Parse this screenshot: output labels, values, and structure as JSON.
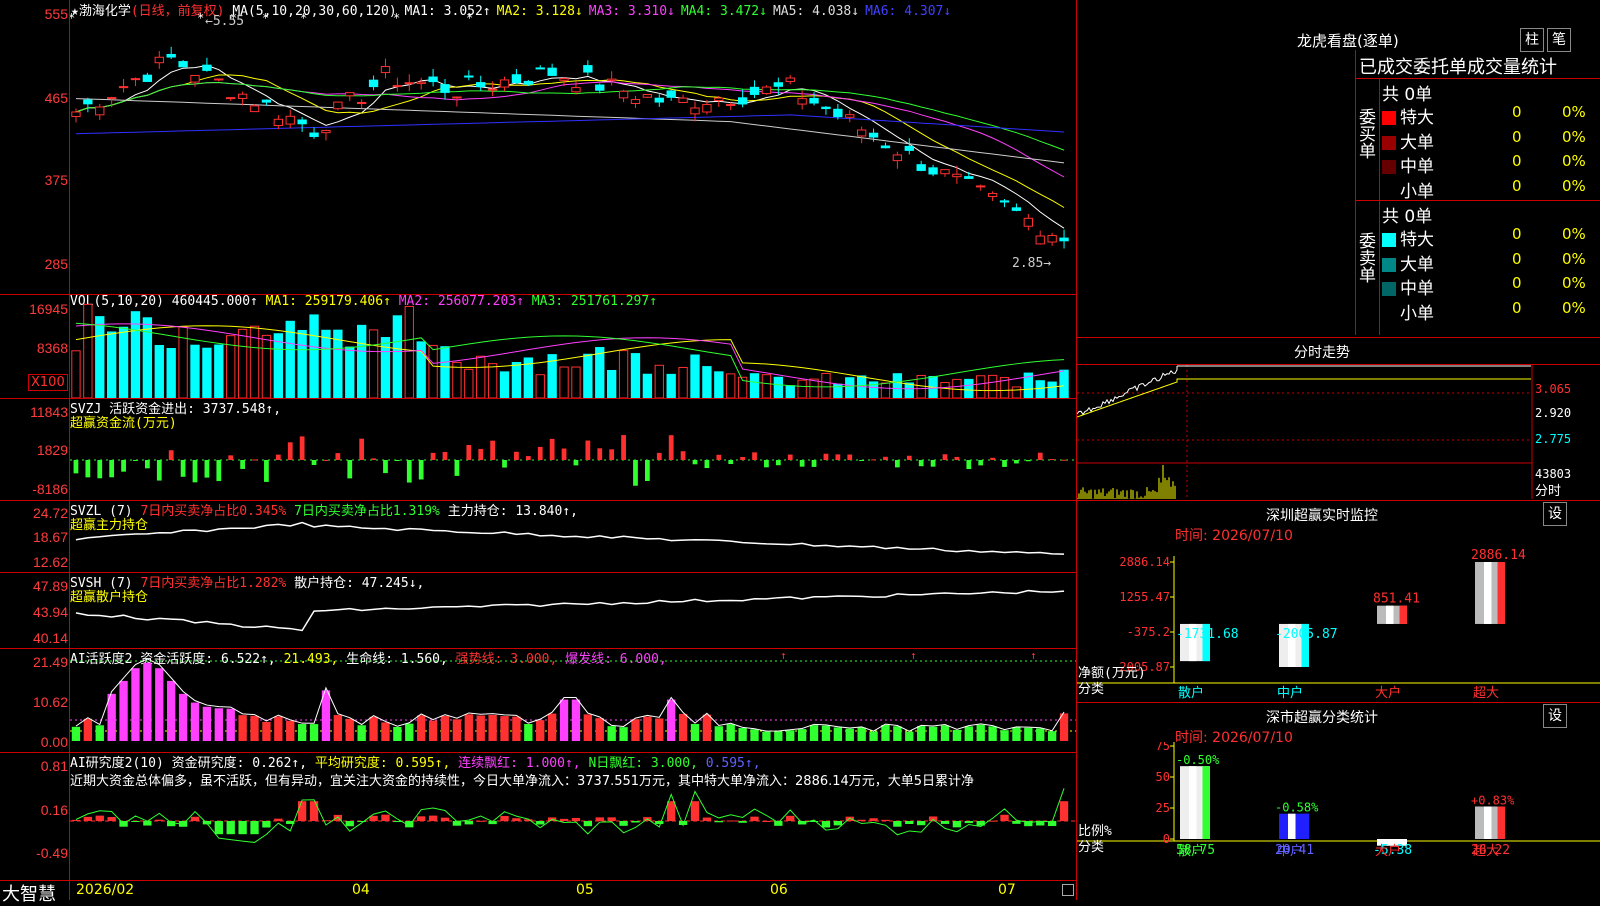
{
  "main_panel": {
    "star": "★",
    "stock_name": "渤海化学",
    "period": "(日线，前复权)",
    "ma_label": "MA(5,10,20,30,60,120)",
    "ma_values": [
      {
        "name": "MA1:",
        "value": "3.052↑",
        "color": "#ffffff"
      },
      {
        "name": "MA2:",
        "value": "3.128↓",
        "color": "#ffff00"
      },
      {
        "name": "MA3:",
        "value": "3.310↓",
        "color": "#ff40ff"
      },
      {
        "name": "MA4:",
        "value": "3.472↓",
        "color": "#30ff30"
      },
      {
        "name": "MA5:",
        "value": "4.038↓",
        "color": "#dddddd"
      },
      {
        "name": "MA6:",
        "value": "4.307↓",
        "color": "#4040ff"
      }
    ],
    "axis": [
      "555",
      "465",
      "375",
      "285"
    ],
    "high_label": "←5.55",
    "low_label": "2.85→"
  },
  "vol_panel": {
    "title": "VOL(5,10,20)",
    "value": "460445.000↑",
    "ma1": "MA1: 259179.406↑",
    "ma2": "MA2: 256077.203↑",
    "ma3": "MA3: 251761.297↑",
    "axis": [
      "16945",
      "8368"
    ],
    "unit": "X100"
  },
  "svzj_panel": {
    "title": "SVZJ  活跃资金进出: 3737.548↑,",
    "subtitle": "超赢资金流(万元)",
    "axis": [
      "11843",
      "1829",
      "-8186"
    ]
  },
  "svzl_panel": {
    "title_a": "SVZL (7)",
    "title_b": "7日内买卖净占比0.345%",
    "title_c": "7日内买卖净占比1.319%",
    "title_d": "主力持仓: 13.840↑,",
    "subtitle": "超赢主力持仓",
    "axis": [
      "24.72",
      "18.67",
      "12.62"
    ]
  },
  "svsh_panel": {
    "title_a": "SVSH (7)",
    "title_b": "7日内买卖净占比1.282%",
    "title_c": "散户持仓: 47.245↓,",
    "subtitle": "超赢散户持仓",
    "axis": [
      "47.89",
      "43.94",
      "40.14"
    ]
  },
  "ai_active_panel": {
    "title_a": "AI活跃度2 资金活跃度: 6.522↑,",
    "title_b": "21.493,",
    "title_c": "生命线: 1.560,",
    "title_d": "强势线: 3.000,",
    "title_e": "爆发线: 6.000,",
    "axis": [
      "21.49",
      "10.62",
      "0.00"
    ]
  },
  "ai_research_panel": {
    "title_a": "AI研究度2(10) 资金研究度: 0.262↑,",
    "title_b": "平均研究度: 0.595↑,",
    "title_c": "连续飘红: 1.000↑,",
    "title_d": "N日飘红: 3.000,",
    "title_e": "0.595↑,",
    "commentary": "近期大资金总体偏多，虽不活跃，但有异动，宜关注大资金的持续性，今日大单净流入：3737.551万元，其中特大单净流入：2886.14万元，大单5日累计净",
    "axis": [
      "0.81",
      "0.16",
      "-0.49"
    ]
  },
  "bottom_bar": {
    "logo": "大智慧",
    "dates": [
      "2026/02",
      "04",
      "05",
      "06",
      "07"
    ]
  },
  "longhu": {
    "title": "龙虎看盘(逐单)",
    "btn1": "柱",
    "btn2": "笔",
    "header": "已成交委托单成交量统计",
    "buy_label": "委买单",
    "sell_label": "委卖单",
    "buy_total": "共 0单",
    "sell_total": "共 0单",
    "rows": [
      {
        "name": "特大",
        "count": "0",
        "pct": "0%"
      },
      {
        "name": "大单",
        "count": "0",
        "pct": "0%"
      },
      {
        "name": "中单",
        "count": "0",
        "pct": "0%"
      },
      {
        "name": "小单",
        "count": "0",
        "pct": "0%"
      }
    ],
    "buy_colors": [
      "#ff0000",
      "#990000",
      "#660000",
      "#000000"
    ],
    "sell_colors": [
      "#00ffff",
      "#008888",
      "#006666",
      "#000000"
    ]
  },
  "intraday": {
    "title": "分时走势",
    "axis": [
      "3.065",
      "2.920",
      "2.775"
    ],
    "vol_label": "43803",
    "vol_unit": "分时"
  },
  "sz_monitor": {
    "title": "深圳超赢实时监控",
    "btn": "设",
    "date": "时间: 2026/07/10",
    "axis": [
      "2886.14",
      "1255.47",
      "-375.2",
      "-2005.87"
    ],
    "ylabel": "净额(万元)",
    "xlabel": "分类",
    "bars": [
      {
        "cat": "散户",
        "value": -1731.68,
        "label": "-1731.68"
      },
      {
        "cat": "中户",
        "value": -2005.87,
        "label": "-2005.87"
      },
      {
        "cat": "大户",
        "value": 851.41,
        "label": "851.41"
      },
      {
        "cat": "超大",
        "value": 2886.14,
        "label": "2886.14"
      }
    ]
  },
  "sz_class": {
    "title": "深市超赢分类统计",
    "btn": "设",
    "date": "时间: 2026/07/10",
    "axis": [
      "75",
      "50",
      "25",
      "0"
    ],
    "ylabel": "比例%",
    "xlabel": "分类",
    "bars": [
      {
        "cat": "散户",
        "value": 58.75,
        "label": "58.75",
        "delta": "-0.50%"
      },
      {
        "cat": "中户",
        "value": 20.41,
        "label": "20.41",
        "delta": "-0.58%"
      },
      {
        "cat": "大户",
        "value": -5.38,
        "label": "-5.38",
        "delta": ""
      },
      {
        "cat": "超大",
        "value": 26.22,
        "label": "26.22",
        "delta": "+0.83%"
      }
    ]
  },
  "chart_data": [
    {
      "type": "bar",
      "title": "深圳超赢实时监控",
      "categories": [
        "散户",
        "中户",
        "大户",
        "超大"
      ],
      "values": [
        -1731.68,
        -2005.87,
        851.41,
        2886.14
      ],
      "ylabel": "净额(万元)",
      "xlabel": "分类",
      "ylim": [
        -2005.87,
        2886.14
      ]
    },
    {
      "type": "bar",
      "title": "深市超赢分类统计",
      "categories": [
        "散户",
        "中户",
        "大户",
        "超大"
      ],
      "values": [
        58.75,
        20.41,
        -5.38,
        26.22
      ],
      "ylabel": "比例%",
      "xlabel": "分类",
      "ylim": [
        0,
        75
      ]
    }
  ]
}
